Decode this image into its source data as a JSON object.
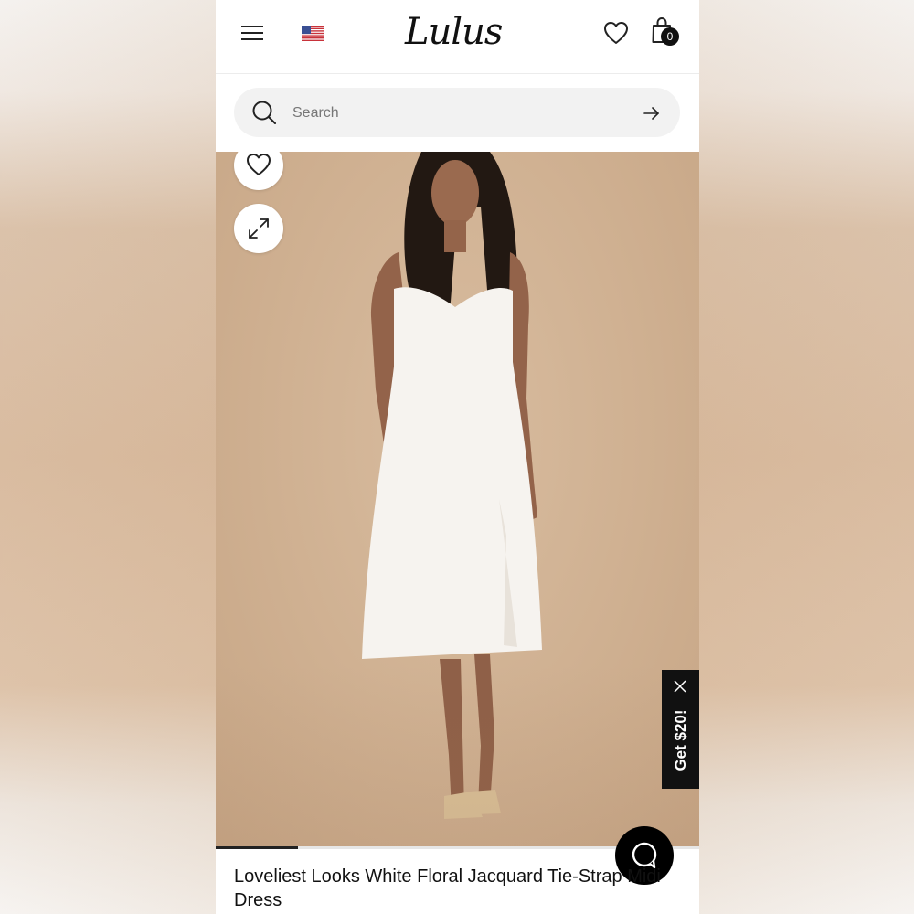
{
  "header": {
    "logo_text": "Lulus",
    "cart_count": "0",
    "icons": [
      "menu-icon",
      "us-flag-icon",
      "heart-icon",
      "shopping-bag-icon"
    ]
  },
  "search": {
    "placeholder": "Search",
    "value": ""
  },
  "promo": {
    "label": "Get $20!"
  },
  "gallery": {
    "progress": 0.17
  },
  "product": {
    "title": "Loveliest Looks White Floral Jacquard Tie-Strap Midi Dress"
  },
  "colors": {
    "accent": "#111111",
    "image_background": "#d4b596"
  }
}
